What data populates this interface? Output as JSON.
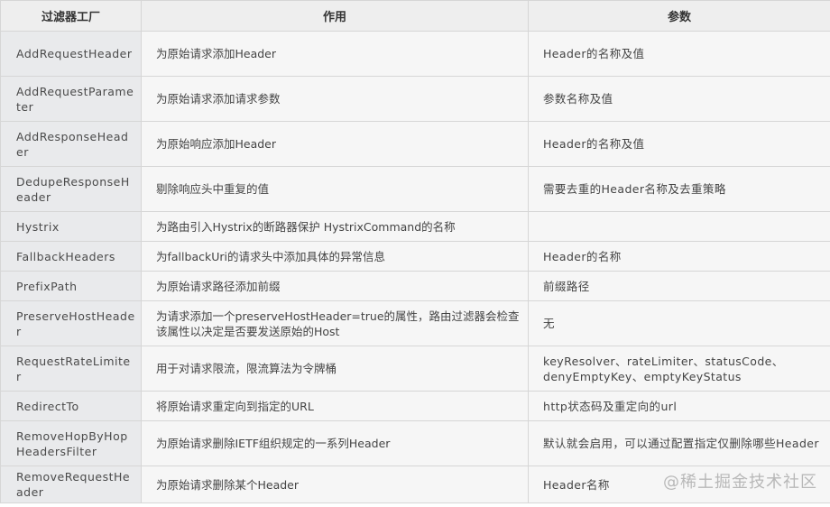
{
  "table": {
    "headers": [
      "过滤器工厂",
      "作用",
      "参数"
    ],
    "rows": [
      {
        "name": "AddRequestHeader",
        "desc": "为原始请求添加Header",
        "param": "Header的名称及值"
      },
      {
        "name": "AddRequestParameter",
        "desc": "为原始请求添加请求参数",
        "param": "参数名称及值"
      },
      {
        "name": "AddResponseHeader",
        "desc": "为原始响应添加Header",
        "param": "Header的名称及值"
      },
      {
        "name": "DedupeResponseHeader",
        "desc": "剔除响应头中重复的值",
        "param": "需要去重的Header名称及去重策略"
      },
      {
        "name": "Hystrix",
        "desc": "为路由引入Hystrix的断路器保护 HystrixCommand的名称",
        "param": ""
      },
      {
        "name": "FallbackHeaders",
        "desc": "为fallbackUri的请求头中添加具体的异常信息",
        "param": "Header的名称"
      },
      {
        "name": "PrefixPath",
        "desc": "为原始请求路径添加前缀",
        "param": "前缀路径"
      },
      {
        "name": "PreserveHostHeader",
        "desc": "为请求添加一个preserveHostHeader=true的属性，路由过滤器会检查该属性以决定是否要发送原始的Host",
        "param": "无"
      },
      {
        "name": "RequestRateLimiter",
        "desc": "用于对请求限流，限流算法为令牌桶",
        "param": "keyResolver、rateLimiter、statusCode、denyEmptyKey、emptyKeyStatus"
      },
      {
        "name": "RedirectTo",
        "desc": "将原始请求重定向到指定的URL",
        "param": "http状态码及重定向的url"
      },
      {
        "name": "RemoveHopByHopHeadersFilter",
        "desc": "为原始请求删除IETF组织规定的一系列Header",
        "param": "默认就会启用，可以通过配置指定仅删除哪些Header"
      },
      {
        "name": "RemoveRequestHeader",
        "desc": "为原始请求删除某个Header",
        "param": "Header名称"
      }
    ]
  },
  "watermark": "@稀土掘金技术社区"
}
